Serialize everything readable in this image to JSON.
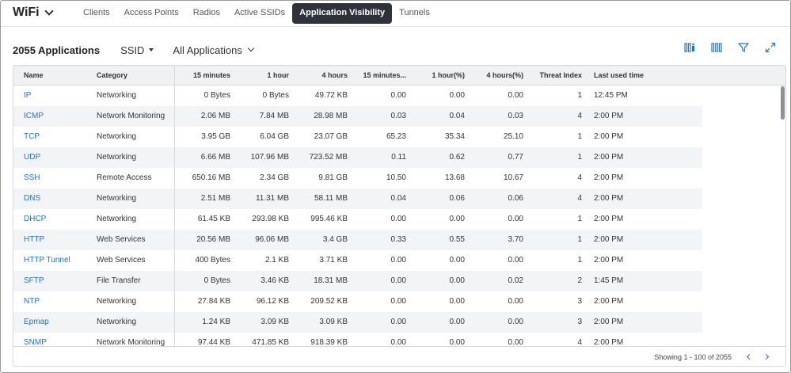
{
  "app": {
    "title": "WiFi"
  },
  "tabs": [
    {
      "label": "Clients",
      "active": false
    },
    {
      "label": "Access Points",
      "active": false
    },
    {
      "label": "Radios",
      "active": false
    },
    {
      "label": "Active SSIDs",
      "active": false
    },
    {
      "label": "Application Visibility",
      "active": true
    },
    {
      "label": "Tunnels",
      "active": false
    }
  ],
  "toolbar": {
    "count_label": "2055 Applications",
    "ssid_label": "SSID",
    "filter_label": "All Applications"
  },
  "icons": [
    "columns-config-icon",
    "columns-icon",
    "filter-icon",
    "expand-icon"
  ],
  "table": {
    "columns": [
      "Name",
      "Category",
      "15 minutes",
      "1 hour",
      "4 hours",
      "15 minutes...",
      "1 hour(%)",
      "4 hours(%)",
      "Threat Index",
      "Last used time"
    ],
    "rows": [
      [
        "IP",
        "Networking",
        "0 Bytes",
        "0 Bytes",
        "49.72 KB",
        "0.00",
        "0.00",
        "0.00",
        "1",
        "12:45 PM"
      ],
      [
        "ICMP",
        "Network Monitoring",
        "2.06 MB",
        "7.84 MB",
        "28.98 MB",
        "0.03",
        "0.04",
        "0.03",
        "4",
        "2:00 PM"
      ],
      [
        "TCP",
        "Networking",
        "3.95 GB",
        "6.04 GB",
        "23.07 GB",
        "65.23",
        "35.34",
        "25.10",
        "1",
        "2:00 PM"
      ],
      [
        "UDP",
        "Networking",
        "6.66 MB",
        "107.96 MB",
        "723.52 MB",
        "0.11",
        "0.62",
        "0.77",
        "1",
        "2:00 PM"
      ],
      [
        "SSH",
        "Remote Access",
        "650.16 MB",
        "2.34 GB",
        "9.81 GB",
        "10.50",
        "13.68",
        "10.67",
        "4",
        "2:00 PM"
      ],
      [
        "DNS",
        "Networking",
        "2.51 MB",
        "11.31 MB",
        "58.11 MB",
        "0.04",
        "0.06",
        "0.06",
        "4",
        "2:00 PM"
      ],
      [
        "DHCP",
        "Networking",
        "61.45 KB",
        "293.98 KB",
        "995.46 KB",
        "0.00",
        "0.00",
        "0.00",
        "1",
        "2:00 PM"
      ],
      [
        "HTTP",
        "Web Services",
        "20.56 MB",
        "96.06 MB",
        "3.4 GB",
        "0.33",
        "0.55",
        "3.70",
        "1",
        "2:00 PM"
      ],
      [
        "HTTP Tunnel",
        "Web Services",
        "400 Bytes",
        "2.1 KB",
        "3.71 KB",
        "0.00",
        "0.00",
        "0.00",
        "1",
        "2:00 PM"
      ],
      [
        "SFTP",
        "File Transfer",
        "0 Bytes",
        "3.46 KB",
        "18.31 MB",
        "0.00",
        "0.00",
        "0.02",
        "2",
        "1:45 PM"
      ],
      [
        "NTP",
        "Networking",
        "27.84 KB",
        "96.12 KB",
        "209.52 KB",
        "0.00",
        "0.00",
        "0.00",
        "3",
        "2:00 PM"
      ],
      [
        "Epmap",
        "Networking",
        "1.24 KB",
        "3.09 KB",
        "3.09 KB",
        "0.00",
        "0.00",
        "0.00",
        "3",
        "2:00 PM"
      ],
      [
        "SNMP",
        "Network Monitoring",
        "97.44 KB",
        "471.85 KB",
        "918.39 KB",
        "0.00",
        "0.00",
        "0.00",
        "4",
        "2:00 PM"
      ]
    ]
  },
  "footer": {
    "showing": "Showing 1 - 100 of 2055"
  },
  "colors": {
    "link": "#1f73c1",
    "active_tab": "#2e333b",
    "header_bg": "#f0f1f3",
    "alt_row": "#f3f4f6"
  }
}
